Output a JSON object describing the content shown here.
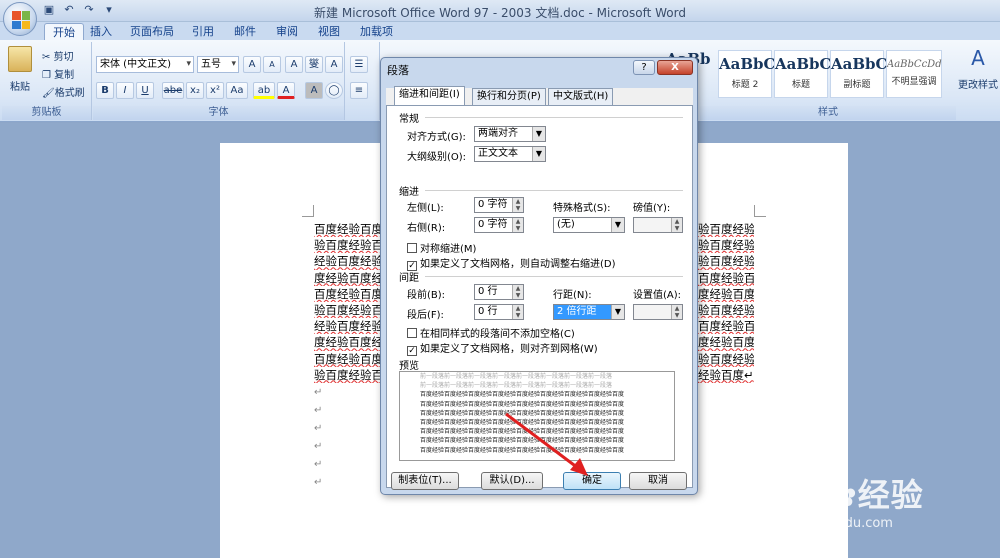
{
  "window": {
    "title": "新建 Microsoft Office Word 97 - 2003 文档.doc - Microsoft Word"
  },
  "tabs": [
    "开始",
    "插入",
    "页面布局",
    "引用",
    "邮件",
    "审阅",
    "视图",
    "加载项"
  ],
  "ribbon": {
    "clipboard": {
      "label": "剪贴板",
      "paste": "粘贴",
      "cut": "剪切",
      "copy": "复制",
      "format_painter": "格式刷"
    },
    "font": {
      "label": "字体",
      "font_name": "宋体 (中文正文)",
      "font_size": "五号",
      "bold": "B",
      "italic": "I",
      "underline": "U",
      "strike": "abe",
      "subscript": "x₂",
      "superscript": "x²",
      "change_case": "Aa",
      "grow": "A",
      "shrink": "A",
      "clear": "A",
      "phonetic": "燮",
      "border_char": "A",
      "highlight": "ab",
      "font_color": "A",
      "char_shade": "A"
    },
    "styles": {
      "label": "样式",
      "items": [
        {
          "sample": "AaBbC",
          "name": "标题 2"
        },
        {
          "sample": "AaBbC",
          "name": "标题"
        },
        {
          "sample": "AaBbC",
          "name": "副标题"
        },
        {
          "sample": "AaBbCcDd",
          "name": "不明显强调"
        }
      ],
      "partial_sample": "AaBb",
      "change_styles": "更改样式"
    }
  },
  "document": {
    "lines_left": [
      "百度经验百度",
      "验百度经验百",
      "经验百度经验",
      "度经验百度经",
      "百度经验百度",
      "验百度经验百",
      "经验百度经验",
      "度经验百度经",
      "百度经验百度",
      "验百度经验百"
    ],
    "lines_right": [
      "百度经验百度经",
      "度经验百度经验百度",
      "验百度经验百度",
      "度经验百度经验",
      "经验百度经验百度",
      "百度经验百度经",
      "度经验百度经验",
      "经验百度经验百度",
      "百度经验百度经",
      "百度经验百度↵"
    ],
    "right_full": [
      "验百度经验百度经",
      "验百度经验百度",
      "验百度经验百度",
      "百度经验百度经验",
      "度经验百度经验",
      "验百度经验百度经",
      "百度经验百度经验",
      "度经验百度经验",
      "验百度经验百度经",
      "经验百度↵"
    ],
    "para_mark": "↵"
  },
  "dialog": {
    "title": "段落",
    "help": "?",
    "close": "X",
    "tabs": [
      "缩进和间距(I)",
      "换行和分页(P)",
      "中文版式(H)"
    ],
    "general": {
      "section": "常规",
      "alignment_label": "对齐方式(G):",
      "alignment_value": "两端对齐",
      "outline_label": "大纲级别(O):",
      "outline_value": "正文文本"
    },
    "indent": {
      "section": "缩进",
      "left_label": "左侧(L):",
      "left_value": "0 字符",
      "right_label": "右侧(R):",
      "right_value": "0 字符",
      "special_label": "特殊格式(S):",
      "special_value": "(无)",
      "by_label": "磅值(Y):",
      "by_value": "",
      "mirror": "对称缩进(M)",
      "auto_adjust": "如果定义了文档网格，则自动调整右缩进(D)"
    },
    "spacing": {
      "section": "间距",
      "before_label": "段前(B):",
      "before_value": "0 行",
      "after_label": "段后(F):",
      "after_value": "0 行",
      "line_label": "行距(N):",
      "line_value": "2 倍行距",
      "at_label": "设置值(A):",
      "at_value": "",
      "no_space": "在相同样式的段落间不添加空格(C)",
      "snap_grid": "如果定义了文档网格，则对齐到网格(W)"
    },
    "preview": {
      "section": "预览",
      "gray_text": "前一段落前一段落前一段落前一段落前一段落前一段落前一段落前一段落",
      "dark_text": "百度经验百度经验百度经验百度经验百度经验百度经验百度经验百度经验百度"
    },
    "buttons": {
      "tabs": "制表位(T)...",
      "default": "默认(D)...",
      "ok": "确定",
      "cancel": "取消"
    }
  },
  "watermark": {
    "brand": "Bai",
    "brand2": "经验",
    "url": "jingyan.baidu.com"
  },
  "colors": {
    "ribbon_text": "#15428b",
    "arrow": "#e02020",
    "wavy_underline": "#e03030"
  }
}
